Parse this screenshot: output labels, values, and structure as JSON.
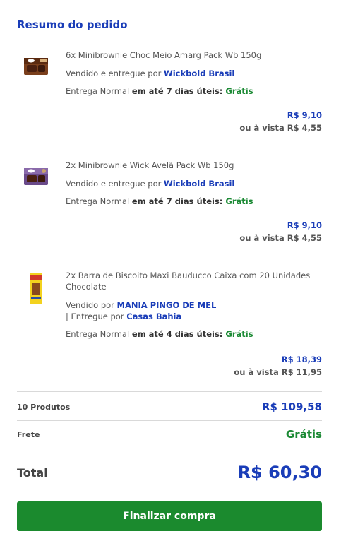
{
  "header": {
    "title": "Resumo do pedido"
  },
  "items": [
    {
      "name": "6x Minibrownie Choc Meio Amarg Pack Wb 150g",
      "sold_prefix": "Vendido e entregue por ",
      "seller": "Wickbold Brasil",
      "delivery_prefix": "Entrega Normal ",
      "delivery_time": "em até 7 dias úteis: ",
      "delivery_cost": "Grátis",
      "price": "R$ 9,10",
      "cash_price": "ou à vista R$ 4,55",
      "thumb_icon": "minibrownie-chocolate-pack-icon"
    },
    {
      "name": "2x Minibrownie Wick Avelã Pack Wb 150g",
      "sold_prefix": "Vendido e entregue por ",
      "seller": "Wickbold Brasil",
      "delivery_prefix": "Entrega Normal ",
      "delivery_time": "em até 7 dias úteis: ",
      "delivery_cost": "Grátis",
      "price": "R$ 9,10",
      "cash_price": "ou à vista R$ 4,55",
      "thumb_icon": "minibrownie-avela-pack-icon"
    },
    {
      "name": "2x Barra de Biscoito Maxi Bauducco Caixa com 20 Unidades Chocolate",
      "sold_prefix": "Vendido por ",
      "seller": "MANIA PINGO DE MEL",
      "delivered_prefix": "| Entregue por ",
      "deliverer": "Casas Bahia",
      "delivery_prefix": "Entrega Normal ",
      "delivery_time": "em até 4 dias úteis: ",
      "delivery_cost": "Grátis",
      "price": "R$ 18,39",
      "cash_price": "ou à vista R$ 11,95",
      "thumb_icon": "bauducco-biscuit-bar-icon"
    }
  ],
  "summary": {
    "products_label": "10 Produtos",
    "products_value": "R$ 109,58",
    "shipping_label": "Frete",
    "shipping_value": "Grátis",
    "total_label": "Total",
    "total_value": "R$ 60,30"
  },
  "checkout_button": "Finalizar compra",
  "colors": {
    "accent_blue": "#1a3db8",
    "green": "#1c8a35",
    "button": "#1b8a2e"
  }
}
